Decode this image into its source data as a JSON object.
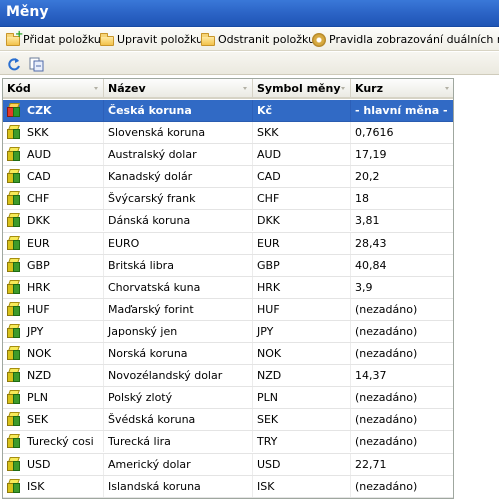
{
  "window": {
    "title": "Měny"
  },
  "toolbar": {
    "add_label": "Přidat položku",
    "edit_label": "Upravit položku",
    "delete_label": "Odstranit položku",
    "rules_label": "Pravidla zobrazování duálních měn"
  },
  "grid": {
    "columns": [
      "Kód",
      "Název",
      "Symbol měny",
      "Kurz"
    ],
    "rows": [
      {
        "code": "CZK",
        "name": "Česká koruna",
        "symbol": "Kč",
        "rate": "- hlavní měna -",
        "selected": true
      },
      {
        "code": "SKK",
        "name": "Slovenská koruna",
        "symbol": "SKK",
        "rate": "0,7616"
      },
      {
        "code": "AUD",
        "name": "Australský dolar",
        "symbol": "AUD",
        "rate": "17,19"
      },
      {
        "code": "CAD",
        "name": "Kanadský dolár",
        "symbol": "CAD",
        "rate": "20,2"
      },
      {
        "code": "CHF",
        "name": "Švýcarský frank",
        "symbol": "CHF",
        "rate": "18"
      },
      {
        "code": "DKK",
        "name": "Dánská koruna",
        "symbol": "DKK",
        "rate": "3,81"
      },
      {
        "code": "EUR",
        "name": "EURO",
        "symbol": "EUR",
        "rate": "28,43"
      },
      {
        "code": "GBP",
        "name": "Britská libra",
        "symbol": "GBP",
        "rate": "40,84"
      },
      {
        "code": "HRK",
        "name": "Chorvatská kuna",
        "symbol": "HRK",
        "rate": "3,9"
      },
      {
        "code": "HUF",
        "name": "Maďarský forint",
        "symbol": "HUF",
        "rate": "(nezadáno)"
      },
      {
        "code": "JPY",
        "name": "Japonský jen",
        "symbol": "JPY",
        "rate": "(nezadáno)"
      },
      {
        "code": "NOK",
        "name": "Norská koruna",
        "symbol": "NOK",
        "rate": "(nezadáno)"
      },
      {
        "code": "NZD",
        "name": "Novozélandský dolar",
        "symbol": "NZD",
        "rate": "14,37"
      },
      {
        "code": "PLN",
        "name": "Polský zlotý",
        "symbol": "PLN",
        "rate": "(nezadáno)"
      },
      {
        "code": "SEK",
        "name": "Švédská koruna",
        "symbol": "SEK",
        "rate": "(nezadáno)"
      },
      {
        "code": "Turecký cosi",
        "name": "Turecká lira",
        "symbol": "TRY",
        "rate": "(nezadáno)"
      },
      {
        "code": "USD",
        "name": "Americký dolar",
        "symbol": "USD",
        "rate": "22,71"
      },
      {
        "code": "ISK",
        "name": "Islandská koruna",
        "symbol": "ISK",
        "rate": "(nezadáno)"
      }
    ]
  },
  "icons": {
    "add": "folder-add-icon",
    "edit": "folder-edit-icon",
    "delete": "folder-delete-icon",
    "rules": "gear-icon",
    "refresh": "refresh-icon",
    "export": "export-icon",
    "row": "currency-cube-icon"
  },
  "colors": {
    "title_bar": "#2a62c4",
    "selection": "#316ac5"
  }
}
